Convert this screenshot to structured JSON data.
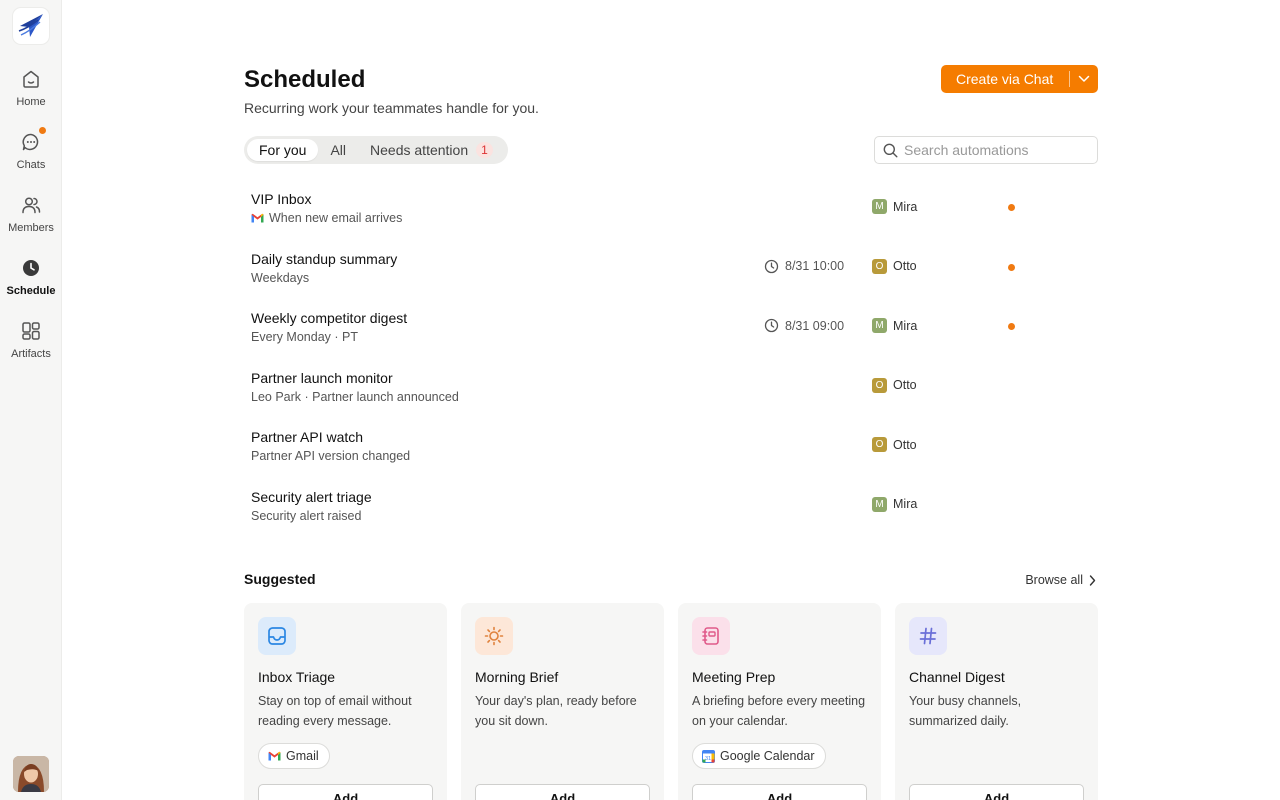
{
  "sidebar": {
    "items": [
      {
        "label": "Home",
        "icon": "home-icon"
      },
      {
        "label": "Chats",
        "icon": "chat-icon",
        "has_notification": true
      },
      {
        "label": "Members",
        "icon": "members-icon"
      },
      {
        "label": "Schedule",
        "icon": "clock-icon",
        "active": true
      },
      {
        "label": "Artifacts",
        "icon": "artifacts-icon"
      }
    ]
  },
  "header": {
    "title": "Scheduled",
    "subtitle": "Recurring work your teammates handle for you.",
    "create_label": "Create via Chat"
  },
  "tabs": [
    {
      "label": "For you",
      "active": true
    },
    {
      "label": "All"
    },
    {
      "label": "Needs attention",
      "badge": "1"
    }
  ],
  "search": {
    "placeholder": "Search automations"
  },
  "automations": [
    {
      "title": "VIP Inbox",
      "subtitle": "When new email arrives",
      "trigger_icon": "gmail-icon",
      "time": "",
      "owner": "Mira",
      "owner_initial": "M",
      "attention": true
    },
    {
      "title": "Daily standup summary",
      "subtitle": "Weekdays",
      "time": "8/31 10:00",
      "owner": "Otto",
      "owner_initial": "O",
      "attention": true
    },
    {
      "title": "Weekly competitor digest",
      "subtitle": "Every Monday · PT",
      "time": "8/31 09:00",
      "owner": "Mira",
      "owner_initial": "M",
      "attention": true
    },
    {
      "title": "Partner launch monitor",
      "subtitle": "Leo Park · Partner launch announced",
      "time": "",
      "owner": "Otto",
      "owner_initial": "O",
      "attention": false
    },
    {
      "title": "Partner API watch",
      "subtitle": "Partner API version changed",
      "time": "",
      "owner": "Otto",
      "owner_initial": "O",
      "attention": false
    },
    {
      "title": "Security alert triage",
      "subtitle": "Security alert raised",
      "time": "",
      "owner": "Mira",
      "owner_initial": "M",
      "attention": false
    }
  ],
  "owner_colors": {
    "Mira": "#8fa86a",
    "Otto": "#b89a3a"
  },
  "accent_color": "#f57c00",
  "suggested": {
    "title": "Suggested",
    "browse_label": "Browse all",
    "cards": [
      {
        "title": "Inbox Triage",
        "description": "Stay on top of email without reading every message.",
        "icon": "inbox-icon",
        "pill": "Gmail",
        "pill_icon": "gmail-icon",
        "add_label": "Add"
      },
      {
        "title": "Morning Brief",
        "description": "Your day's plan, ready before you sit down.",
        "icon": "sun-icon",
        "pill": "",
        "add_label": "Add"
      },
      {
        "title": "Meeting Prep",
        "description": "A briefing before every meeting on your calendar.",
        "icon": "notebook-icon",
        "pill": "Google Calendar",
        "pill_icon": "google-calendar-icon",
        "add_label": "Add"
      },
      {
        "title": "Channel Digest",
        "description": "Your busy channels, summarized daily.",
        "icon": "hash-icon",
        "pill": "",
        "add_label": "Add"
      }
    ]
  }
}
